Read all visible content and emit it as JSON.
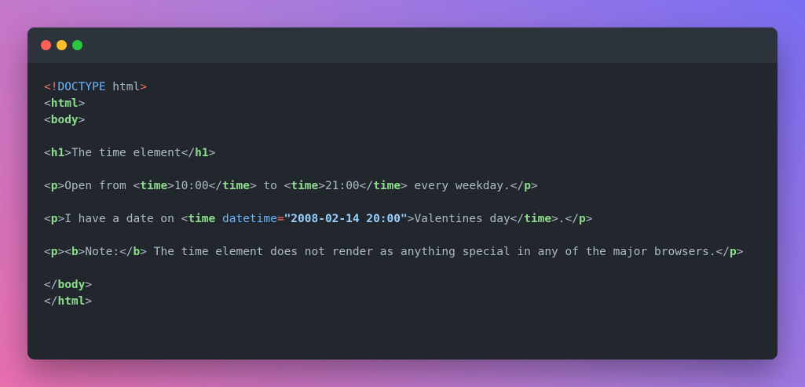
{
  "colors": {
    "background_gradient": [
      "#e96fae",
      "#b07cd8",
      "#7a6ef2"
    ],
    "window": "#22272e",
    "titlebar": "#2d333b",
    "tag": "#8ddb8c",
    "keyword": "#6cb6ff",
    "string": "#96d0ff",
    "text": "#adbac7",
    "doctype_bracket": "#f47067"
  },
  "window_controls": [
    "close",
    "minimize",
    "maximize"
  ],
  "code": {
    "lines": [
      [
        {
          "t": "<!",
          "c": "d"
        },
        {
          "t": "DOCTYPE",
          "c": "k"
        },
        {
          "t": " html",
          "c": "x"
        },
        {
          "t": ">",
          "c": "d"
        }
      ],
      [
        {
          "t": "<",
          "c": "p"
        },
        {
          "t": "html",
          "c": "t"
        },
        {
          "t": ">",
          "c": "p"
        }
      ],
      [
        {
          "t": "<",
          "c": "p"
        },
        {
          "t": "body",
          "c": "t"
        },
        {
          "t": ">",
          "c": "p"
        }
      ],
      [],
      [
        {
          "t": "<",
          "c": "p"
        },
        {
          "t": "h1",
          "c": "t"
        },
        {
          "t": ">",
          "c": "p"
        },
        {
          "t": "The time element",
          "c": "x"
        },
        {
          "t": "</",
          "c": "p"
        },
        {
          "t": "h1",
          "c": "t"
        },
        {
          "t": ">",
          "c": "p"
        }
      ],
      [],
      [
        {
          "t": "<",
          "c": "p"
        },
        {
          "t": "p",
          "c": "t"
        },
        {
          "t": ">",
          "c": "p"
        },
        {
          "t": "Open from ",
          "c": "x"
        },
        {
          "t": "<",
          "c": "p"
        },
        {
          "t": "time",
          "c": "t"
        },
        {
          "t": ">",
          "c": "p"
        },
        {
          "t": "10:00",
          "c": "x"
        },
        {
          "t": "</",
          "c": "p"
        },
        {
          "t": "time",
          "c": "t"
        },
        {
          "t": ">",
          "c": "p"
        },
        {
          "t": " to ",
          "c": "x"
        },
        {
          "t": "<",
          "c": "p"
        },
        {
          "t": "time",
          "c": "t"
        },
        {
          "t": ">",
          "c": "p"
        },
        {
          "t": "21:00",
          "c": "x"
        },
        {
          "t": "</",
          "c": "p"
        },
        {
          "t": "time",
          "c": "t"
        },
        {
          "t": ">",
          "c": "p"
        },
        {
          "t": " every weekday.",
          "c": "x"
        },
        {
          "t": "</",
          "c": "p"
        },
        {
          "t": "p",
          "c": "t"
        },
        {
          "t": ">",
          "c": "p"
        }
      ],
      [],
      [
        {
          "t": "<",
          "c": "p"
        },
        {
          "t": "p",
          "c": "t"
        },
        {
          "t": ">",
          "c": "p"
        },
        {
          "t": "I have a date on ",
          "c": "x"
        },
        {
          "t": "<",
          "c": "p"
        },
        {
          "t": "time",
          "c": "t"
        },
        {
          "t": " ",
          "c": "x"
        },
        {
          "t": "datetime",
          "c": "a"
        },
        {
          "t": "=",
          "c": "d"
        },
        {
          "t": "\"2008-02-14 20:00\"",
          "c": "s"
        },
        {
          "t": ">",
          "c": "p"
        },
        {
          "t": "Valentines day",
          "c": "x"
        },
        {
          "t": "</",
          "c": "p"
        },
        {
          "t": "time",
          "c": "t"
        },
        {
          "t": ">",
          "c": "p"
        },
        {
          "t": ".",
          "c": "x"
        },
        {
          "t": "</",
          "c": "p"
        },
        {
          "t": "p",
          "c": "t"
        },
        {
          "t": ">",
          "c": "p"
        }
      ],
      [],
      [
        {
          "t": "<",
          "c": "p"
        },
        {
          "t": "p",
          "c": "t"
        },
        {
          "t": ">",
          "c": "p"
        },
        {
          "t": "<",
          "c": "p"
        },
        {
          "t": "b",
          "c": "t"
        },
        {
          "t": ">",
          "c": "p"
        },
        {
          "t": "Note:",
          "c": "x"
        },
        {
          "t": "</",
          "c": "p"
        },
        {
          "t": "b",
          "c": "t"
        },
        {
          "t": ">",
          "c": "p"
        },
        {
          "t": " The time element does not render as anything special in any of the major browsers.",
          "c": "x"
        },
        {
          "t": "</",
          "c": "p"
        },
        {
          "t": "p",
          "c": "t"
        },
        {
          "t": ">",
          "c": "p"
        }
      ],
      [],
      [
        {
          "t": "</",
          "c": "p"
        },
        {
          "t": "body",
          "c": "t"
        },
        {
          "t": ">",
          "c": "p"
        }
      ],
      [
        {
          "t": "</",
          "c": "p"
        },
        {
          "t": "html",
          "c": "t"
        },
        {
          "t": ">",
          "c": "p"
        }
      ]
    ]
  }
}
